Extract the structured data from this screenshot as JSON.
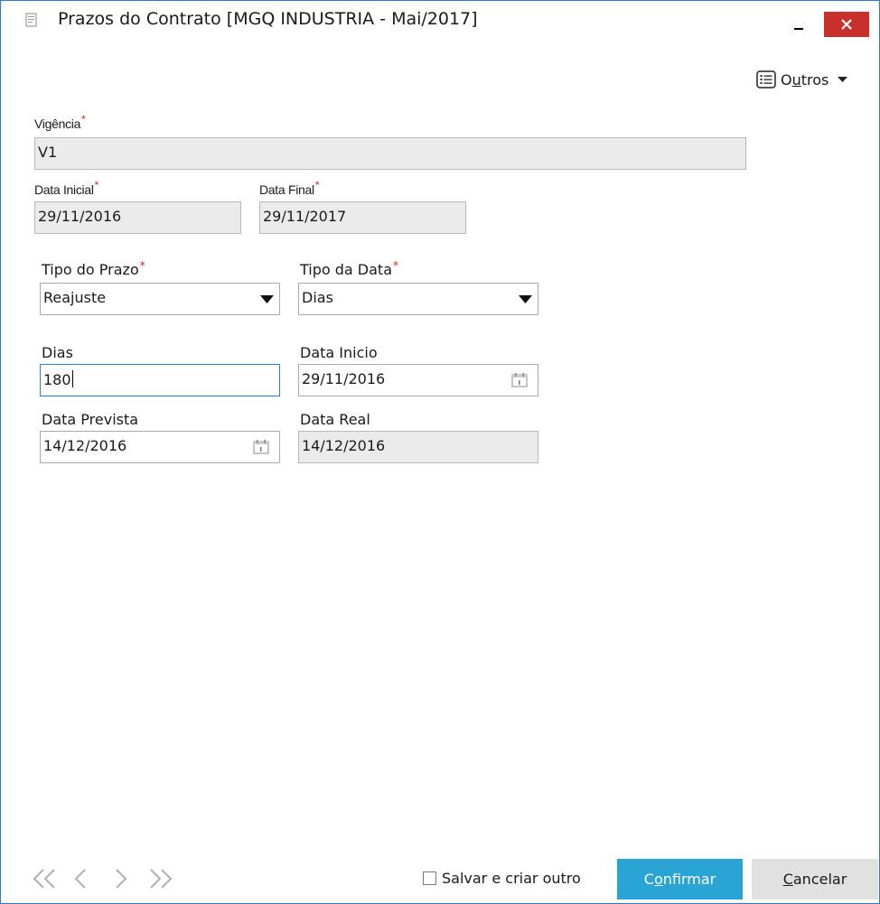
{
  "window": {
    "title": "Prazos do Contrato [MGQ INDUSTRIA - Mai/2017]",
    "accent_color": "#2b79d6",
    "close_color": "#c9302c"
  },
  "toolbar": {
    "outros_prefix": "O",
    "outros_underlined": "u",
    "outros_suffix": "tros",
    "outros_icon": "list-icon"
  },
  "form": {
    "vigencia": {
      "label": "Vigência",
      "value": "V1"
    },
    "data_inicial": {
      "label": "Data Inicial",
      "value": "29/11/2016"
    },
    "data_final": {
      "label": "Data Final",
      "value": "29/11/2017"
    },
    "tipo_prazo": {
      "label": "Tipo do Prazo",
      "value": "Reajuste"
    },
    "tipo_data": {
      "label": "Tipo da Data",
      "value": "Dias"
    },
    "dias": {
      "label": "Dias",
      "value": "180"
    },
    "data_inicio": {
      "label": "Data Inicio",
      "value": "29/11/2016"
    },
    "data_prevista": {
      "label": "Data Prevista",
      "value": "14/12/2016"
    },
    "data_real": {
      "label": "Data Real",
      "value": "14/12/2016"
    },
    "required_marker": "*"
  },
  "footer": {
    "save_and_new_label": "Salvar e criar outro",
    "confirm_prefix": "C",
    "confirm_underlined": "o",
    "confirm_suffix": "nfirmar",
    "cancel_underlined": "C",
    "cancel_suffix": "ancelar",
    "confirm_color": "#2aa4d5"
  }
}
